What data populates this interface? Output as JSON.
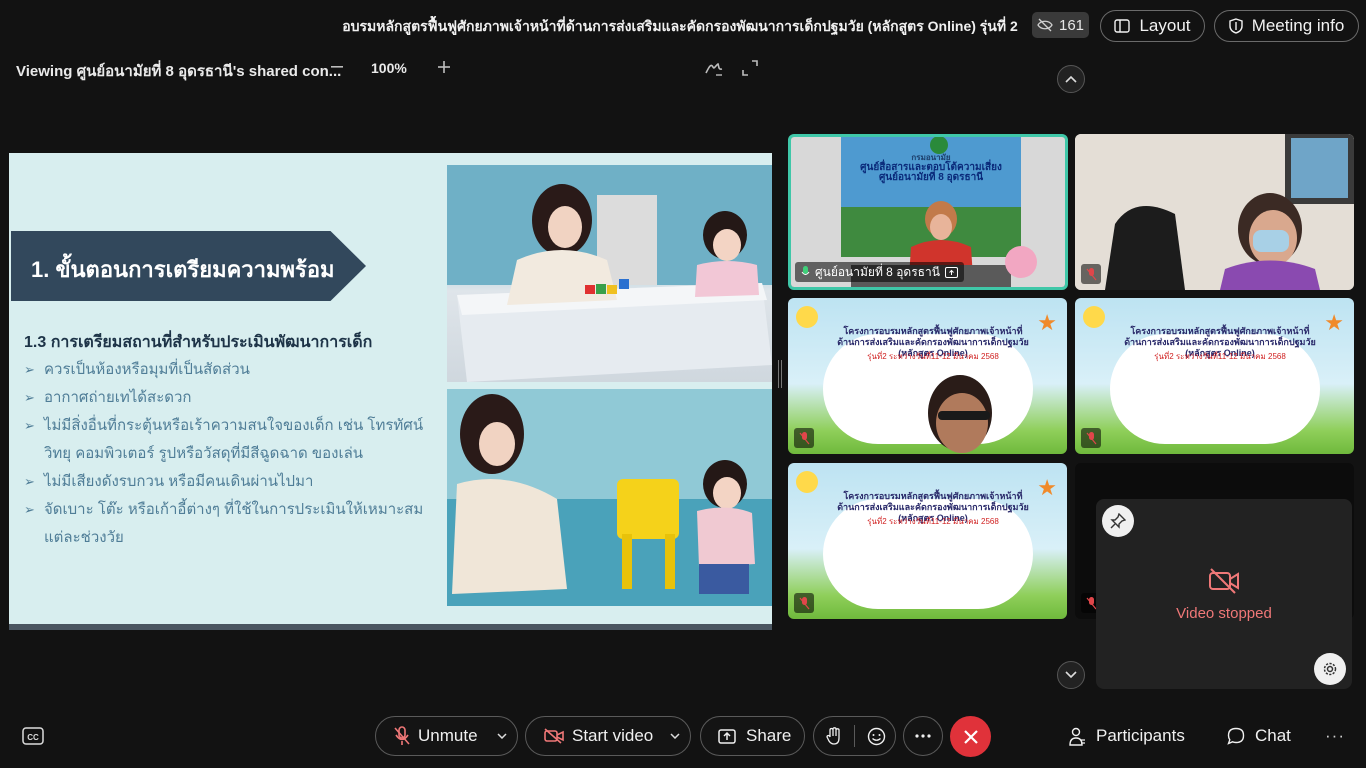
{
  "header": {
    "meeting_title": "อบรมหลักสูตรฟื้นฟูศักยภาพเจ้าหน้าที่ด้านการส่งเสริมและคัดกรองพัฒนาการเด็กปฐมวัย (หลักสูตร Online) รุ่นที่ 2",
    "participant_count": "161",
    "layout_label": "Layout",
    "meeting_info_label": "Meeting info"
  },
  "share_bar": {
    "viewing_text": "Viewing ศูนย์อนามัยที่ 8 อุดรธานี's shared con...",
    "zoom_level": "100%"
  },
  "slide": {
    "heading": "1. ขั้นตอนการเตรียมความพร้อม",
    "subheading": "1.3 การเตรียมสถานที่สำหรับประเมินพัฒนาการเด็ก",
    "bullets": [
      "ควรเป็นห้องหรือมุมที่เป็นสัดส่วน",
      "อากาศถ่ายเทได้สะดวก",
      "ไม่มีสิ่งอื่นที่กระตุ้นหรือเร้าความสนใจของเด็ก เช่น โทรทัศน์ วิทยุ คอมพิวเตอร์ รูปหรือวัสดุที่มีสีฉูดฉาด ของเล่น",
      "ไม่มีเสียงดังรบกวน หรือมีคนเดินผ่านไปมา",
      "จัดเบาะ โต๊ะ หรือเก้าอี้ต่างๆ ที่ใช้ในการประเมินให้เหมาะสมแต่ละช่วงวัย"
    ]
  },
  "video_grid": {
    "main_tile_name": "ศูนย์อนามัยที่ 8 อุดรธานี",
    "main_tile_text_lines": [
      "กรมอนามัย",
      "ศูนย์สื่อสารและตอบโต้ความเสี่ยง",
      "ศูนย์อนามัยที่ 8 อุดรธานี"
    ],
    "card_title_line1": "โครงการอบรมหลักสูตรฟื้นฟูศักยภาพเจ้าหน้าที่",
    "card_title_line2": "ด้านการส่งเสริมและคัดกรองพัฒนาการเด็กปฐมวัย (หลักสูตร Online)",
    "card_date": "รุ่นที่2 ระหว่างวันที่11-12 มีนาคม 2568"
  },
  "self_view": {
    "status_label": "Video stopped"
  },
  "toolbar": {
    "unmute_label": "Unmute",
    "start_video_label": "Start video",
    "share_label": "Share",
    "participants_label": "Participants",
    "chat_label": "Chat"
  },
  "colors": {
    "background": "#121212",
    "leave_button": "#e0323a",
    "active_speaker_border": "#3fc7a8",
    "slide_banner": "#32485c",
    "video_stopped_text": "#f07878"
  }
}
